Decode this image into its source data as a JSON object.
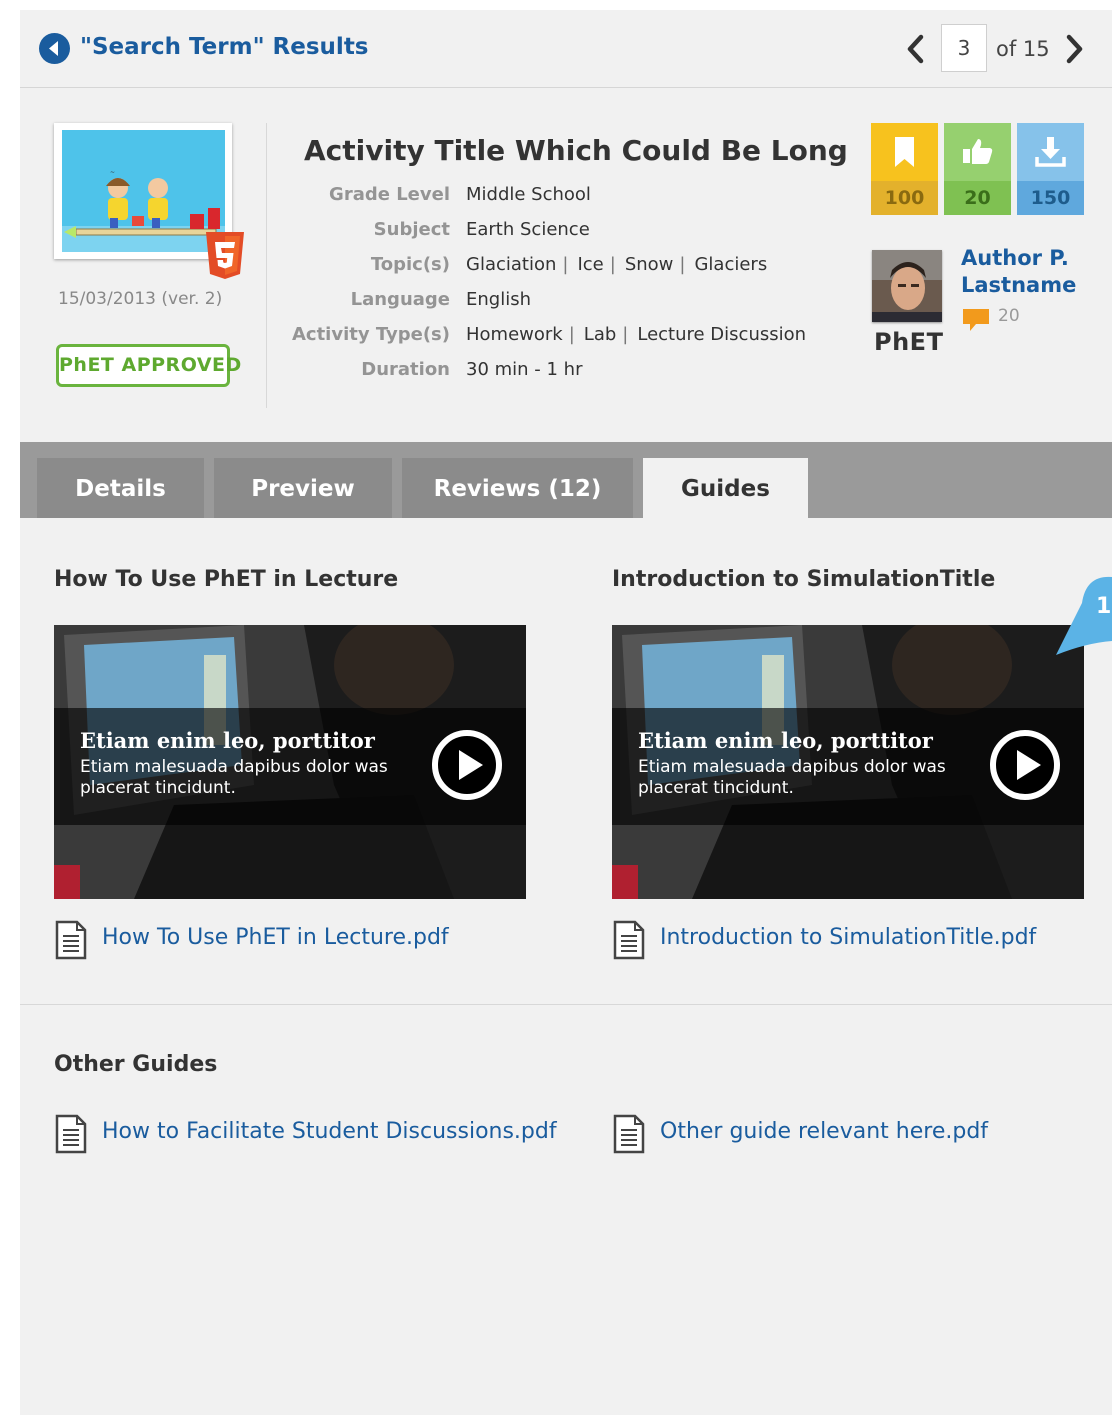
{
  "topbar": {
    "title": "\"Search Term\" Results",
    "page_current": "3",
    "page_of": "of 15"
  },
  "header": {
    "date": "15/03/2013 (ver. 2)",
    "approved_label": "PhET APPROVED",
    "activity_title": "Activity Title Which Could Be Long",
    "meta": {
      "grade_level_label": "Grade Level",
      "grade_level": "Middle School",
      "subject_label": "Subject",
      "subject": "Earth Science",
      "topics_label": "Topic(s)",
      "topics": [
        "Glaciation",
        "Ice",
        "Snow",
        "Glaciers"
      ],
      "language_label": "Language",
      "language": "English",
      "activity_types_label": "Activity Type(s)",
      "activity_types": [
        "Homework",
        "Lab",
        "Lecture Discussion"
      ],
      "duration_label": "Duration",
      "duration": "30 min - 1 hr"
    },
    "stats": {
      "bookmarks": "100",
      "likes": "20",
      "downloads": "150"
    },
    "author": {
      "name": "Author P. Lastname",
      "org": "PhET",
      "comments": "20"
    },
    "icons": [
      "html5-icon",
      "bookmark-icon",
      "thumbs-up-icon",
      "download-icon",
      "comment-icon"
    ],
    "colors": {
      "accent_blue": "#1a5c9e",
      "approved_green": "#6ab43e",
      "bookmark_yellow": "#f7c21e",
      "like_green": "#96d06f",
      "download_blue": "#86c2ea"
    }
  },
  "tabs": [
    {
      "label": "Details",
      "active": false
    },
    {
      "label": "Preview",
      "active": false
    },
    {
      "label": "Reviews (12)",
      "active": false
    },
    {
      "label": "Guides",
      "active": true
    }
  ],
  "guides": [
    {
      "title": "How To Use PhET in Lecture",
      "video_headline": "Etiam enim leo, porttitor",
      "video_desc": "Etiam malesuada dapibus dolor was placerat tincidunt.",
      "file": "How To Use PhET in Lecture.pdf"
    },
    {
      "title": "Introduction to SimulationTitle",
      "video_headline": "Etiam enim leo, porttitor",
      "video_desc": "Etiam malesuada dapibus dolor was placerat tincidunt.",
      "file": "Introduction to SimulationTitle.pdf"
    }
  ],
  "other_guides": {
    "title": "Other Guides",
    "files": [
      "How to Facilitate Student Discussions.pdf",
      "Other guide relevant here.pdf"
    ]
  },
  "callout": "1"
}
